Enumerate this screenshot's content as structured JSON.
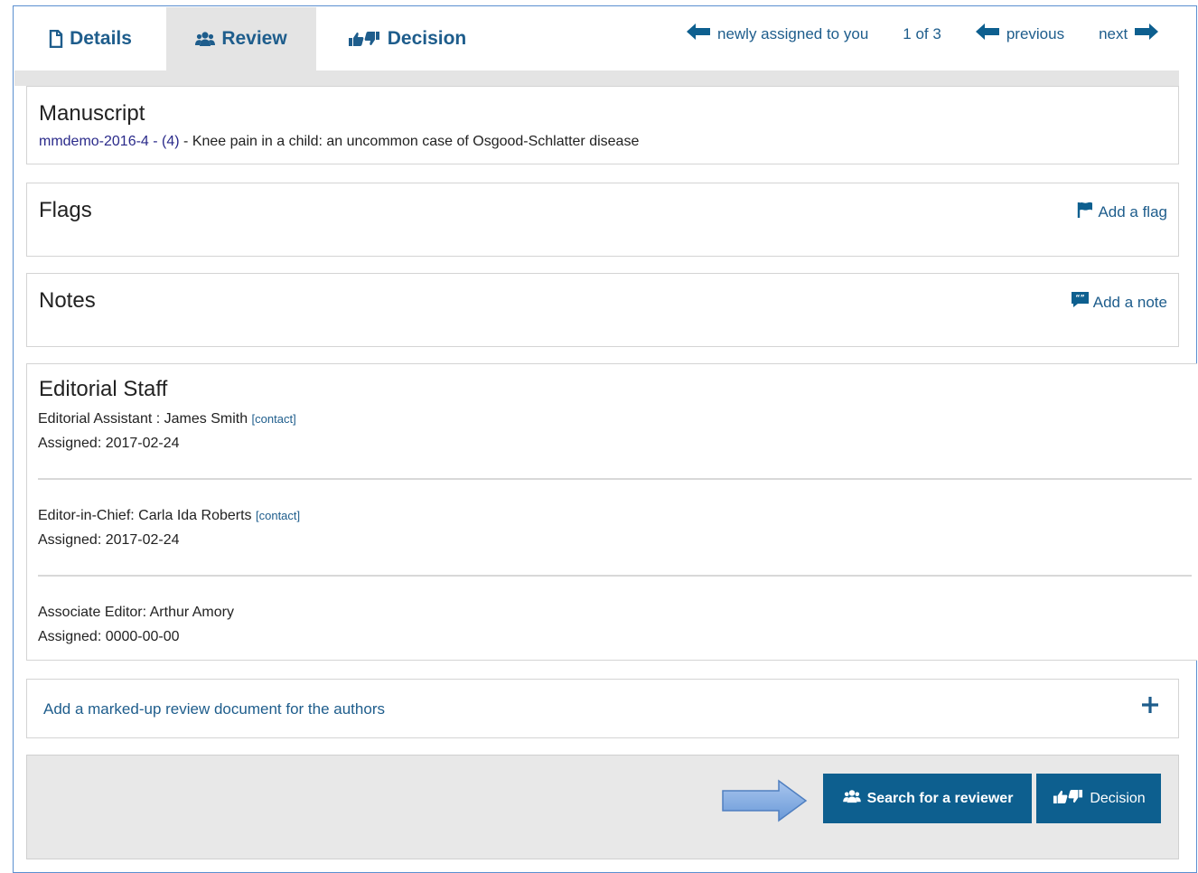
{
  "tabs": {
    "details": "Details",
    "review": "Review",
    "decision": "Decision"
  },
  "nav": {
    "newly_assigned": "newly assigned to you",
    "count": "1 of 3",
    "previous": "previous",
    "next": "next"
  },
  "manuscript": {
    "title": "Manuscript",
    "id_link": "mmdemo-2016-4 - (4)",
    "description": " - Knee pain in a child: an uncommon case of Osgood-Schlatter disease"
  },
  "flags": {
    "title": "Flags",
    "add_label": "Add a flag"
  },
  "notes": {
    "title": "Notes",
    "add_label": "Add a note"
  },
  "editorial_staff": {
    "title": "Editorial Staff",
    "members": [
      {
        "role_name": "Editorial Assistant : James Smith",
        "contact": "[contact]",
        "assigned": "Assigned: 2017-02-24"
      },
      {
        "role_name": "Editor-in-Chief: Carla Ida Roberts",
        "contact": "[contact]",
        "assigned": "Assigned: 2017-02-24"
      },
      {
        "role_name": "Associate Editor: Arthur Amory",
        "contact": "",
        "assigned": "Assigned: 0000-00-00"
      }
    ]
  },
  "markup": {
    "label": "Add a marked-up review document for the authors"
  },
  "footer": {
    "search_reviewer": "Search for a reviewer",
    "decision": "Decision"
  },
  "colors": {
    "accent": "#1e5d8c",
    "button": "#0d5f8f",
    "tab_active_bg": "#e4e4e4"
  }
}
